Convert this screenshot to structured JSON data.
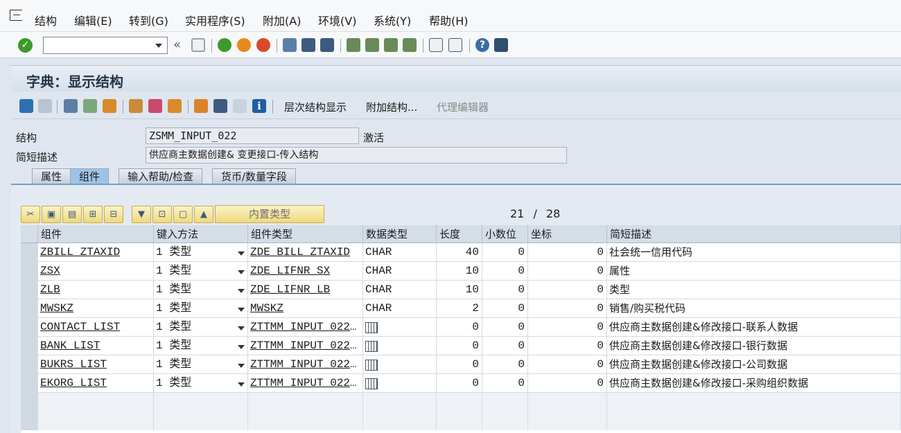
{
  "menu": {
    "items": [
      "结构",
      "编辑(E)",
      "转到(G)",
      "实用程序(S)",
      "附加(A)",
      "环境(V)",
      "系统(Y)",
      "帮助(H)"
    ]
  },
  "toolbar": {
    "command_value": "",
    "back_arrows": "«"
  },
  "title": "字典：显示结构",
  "app_toolbar": {
    "hierarchy_label": "层次结构显示",
    "append_label": "附加结构...",
    "proxy_label": "代理编辑器"
  },
  "header": {
    "structure_label": "结构",
    "structure_value": "ZSMM_INPUT_022",
    "status": "激活",
    "desc_label": "简短描述",
    "desc_value": "供应商主数据创建& 变更接口-传入结构"
  },
  "tabs": [
    "属性",
    "组件",
    "输入帮助/检查",
    "货币/数量字段"
  ],
  "active_tab": "组件",
  "table_toolbar": {
    "builtin_label": "内置类型",
    "page_current": "21",
    "page_sep": "/",
    "page_total": "28"
  },
  "grid": {
    "columns": [
      "组件",
      "键入方法",
      "组件类型",
      "数据类型",
      "长度",
      "小数位",
      "坐标",
      "简短描述"
    ],
    "rows": [
      {
        "component": "ZBILL_ZTAXID",
        "method": "1 类型",
        "comp_type": "ZDE_BILL_ZTAXID",
        "data_type": "CHAR",
        "length": "40",
        "decimals": "0",
        "coord": "0",
        "desc": "社会统一信用代码"
      },
      {
        "component": "ZSX",
        "method": "1 类型",
        "comp_type": "ZDE_LIFNR_SX",
        "data_type": "CHAR",
        "length": "10",
        "decimals": "0",
        "coord": "0",
        "desc": "属性"
      },
      {
        "component": "ZLB",
        "method": "1 类型",
        "comp_type": "ZDE_LIFNR_LB",
        "data_type": "CHAR",
        "length": "10",
        "decimals": "0",
        "coord": "0",
        "desc": "类型"
      },
      {
        "component": "MWSKZ",
        "method": "1 类型",
        "comp_type": "MWSKZ",
        "data_type": "CHAR",
        "length": "2",
        "decimals": "0",
        "coord": "0",
        "desc": "销售/购买税代码"
      },
      {
        "component": "CONTACT_LIST",
        "method": "1 类型",
        "comp_type": "ZTTMM_INPUT_022...",
        "data_type": "table-icon",
        "length": "0",
        "decimals": "0",
        "coord": "0",
        "desc": "供应商主数据创建&修改接口-联系人数据"
      },
      {
        "component": "BANK_LIST",
        "method": "1 类型",
        "comp_type": "ZTTMM_INPUT_022...",
        "data_type": "table-icon",
        "length": "0",
        "decimals": "0",
        "coord": "0",
        "desc": "供应商主数据创建&修改接口-银行数据"
      },
      {
        "component": "BUKRS_LIST",
        "method": "1 类型",
        "comp_type": "ZTTMM_INPUT_022...",
        "data_type": "table-icon",
        "length": "0",
        "decimals": "0",
        "coord": "0",
        "desc": "供应商主数据创建&修改接口-公司数据"
      },
      {
        "component": "EKORG_LIST",
        "method": "1 类型",
        "comp_type": "ZTTMM_INPUT_022...",
        "data_type": "table-icon",
        "length": "0",
        "decimals": "0",
        "coord": "0",
        "desc": "供应商主数据创建&修改接口-采购组织数据"
      }
    ]
  }
}
